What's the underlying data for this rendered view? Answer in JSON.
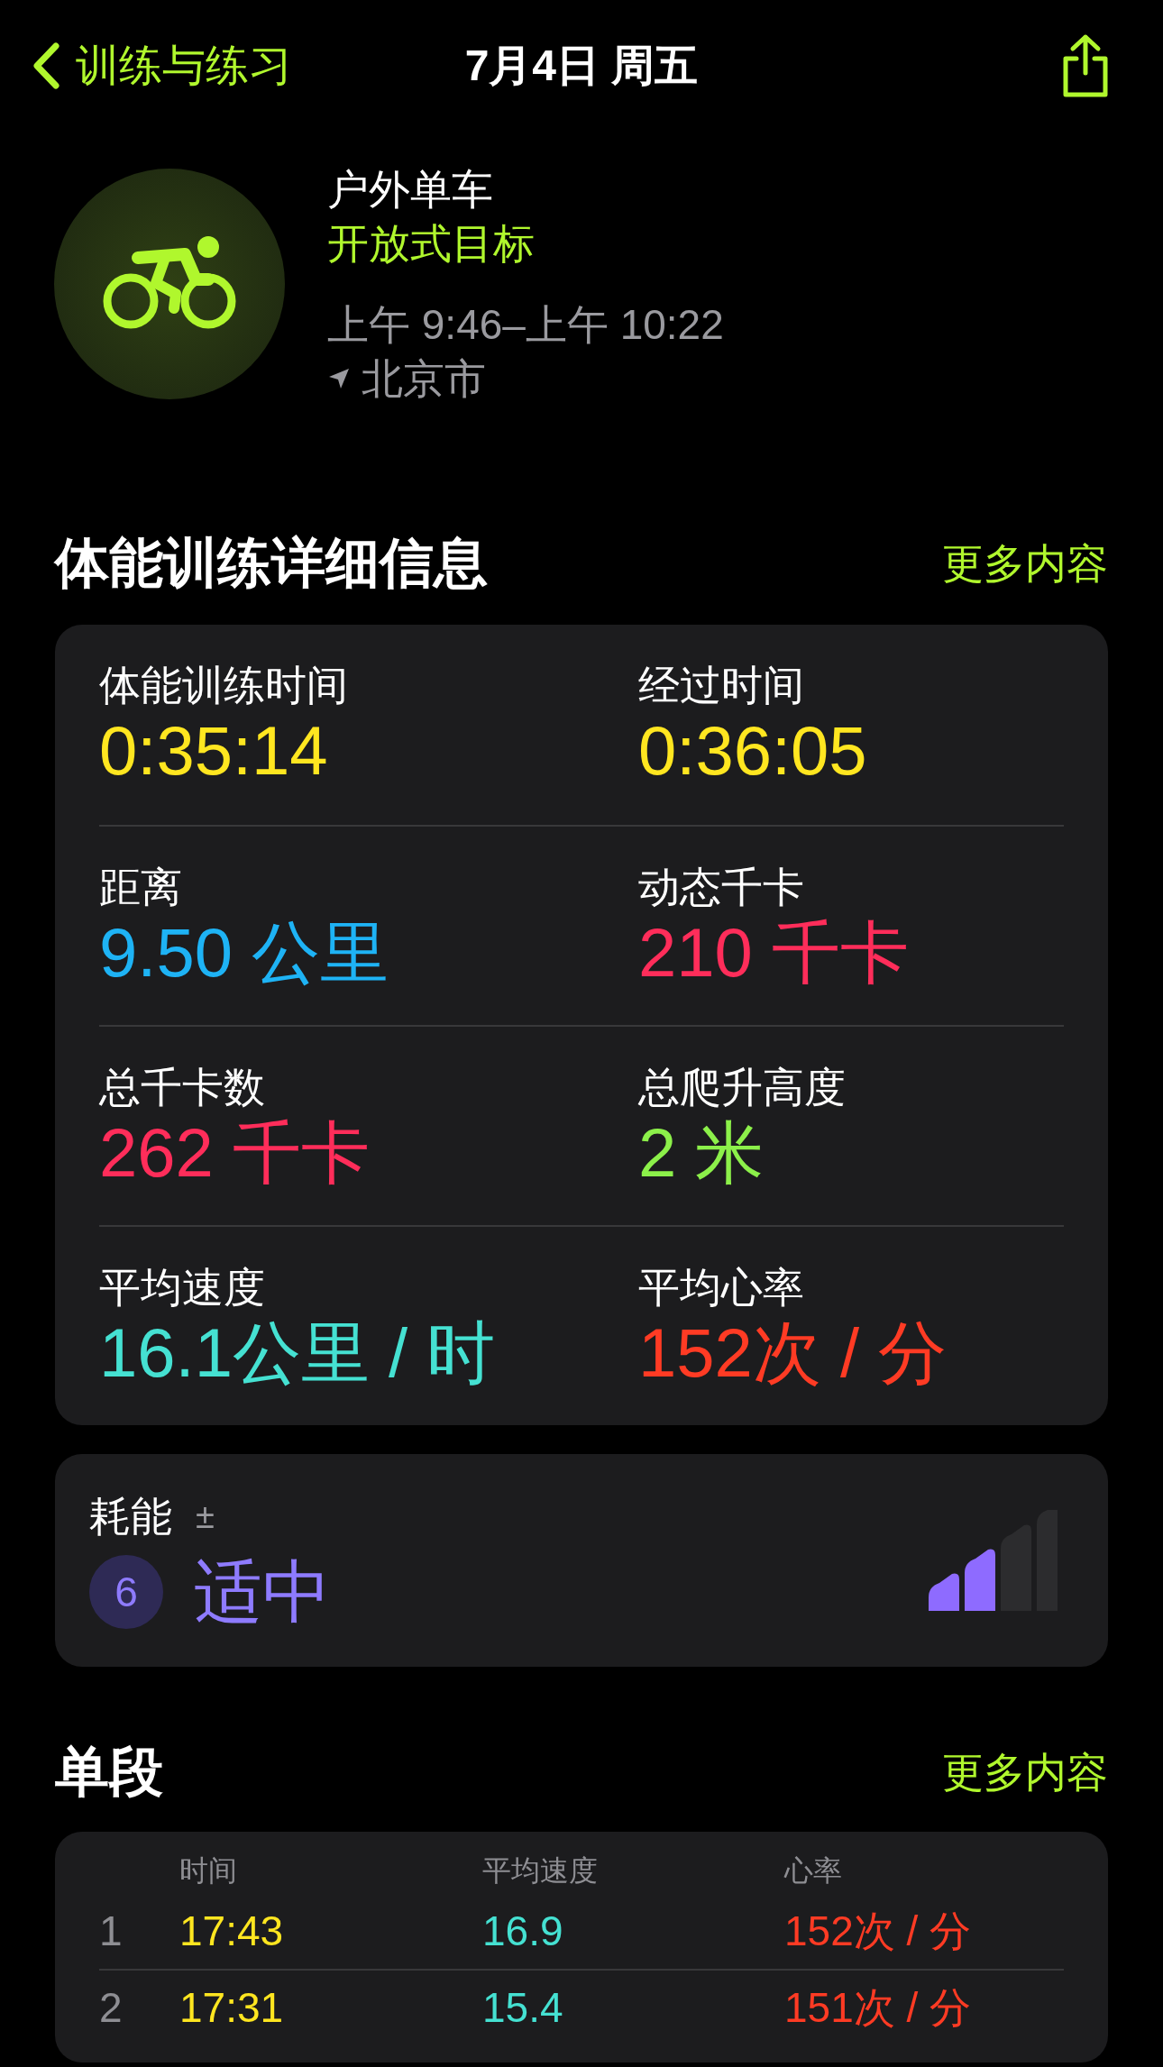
{
  "nav": {
    "back_label": "训练与练习",
    "title": "7月4日 周五"
  },
  "workout": {
    "name": "户外单车",
    "goal": "开放式目标",
    "time_range": "上午 9:46–上午 10:22",
    "location": "北京市"
  },
  "details": {
    "title": "体能训练详细信息",
    "more": "更多内容",
    "metrics": [
      {
        "label": "体能训练时间",
        "value": "0:35:14",
        "color": "#ffe620"
      },
      {
        "label": "经过时间",
        "value": "0:36:05",
        "color": "#ffe620"
      },
      {
        "label": "距离",
        "value": "9.50 公里",
        "color": "#1eb3f5"
      },
      {
        "label": "动态千卡",
        "value": "210 千卡",
        "color": "#ff2d5a"
      },
      {
        "label": "总千卡数",
        "value": "262 千卡",
        "color": "#ff2d5a"
      },
      {
        "label": "总爬升高度",
        "value": "2 米",
        "color": "#8cf04a"
      },
      {
        "label": "平均速度",
        "value": "16.1公里 / 时",
        "color": "#45e1d2"
      },
      {
        "label": "平均心率",
        "value": "152次 / 分",
        "color": "#ff3b24"
      }
    ]
  },
  "effort": {
    "label": "耗能",
    "info": "±",
    "score": "6",
    "rating": "适中",
    "level": 0.5
  },
  "segments": {
    "title": "单段",
    "more": "更多内容",
    "columns": [
      "时间",
      "平均速度",
      "心率"
    ],
    "rows": [
      {
        "index": "1",
        "time": "17:43",
        "speed": "16.9",
        "heart_rate": "152次 / 分"
      },
      {
        "index": "2",
        "time": "17:31",
        "speed": "15.4",
        "heart_rate": "151次 / 分"
      }
    ]
  }
}
